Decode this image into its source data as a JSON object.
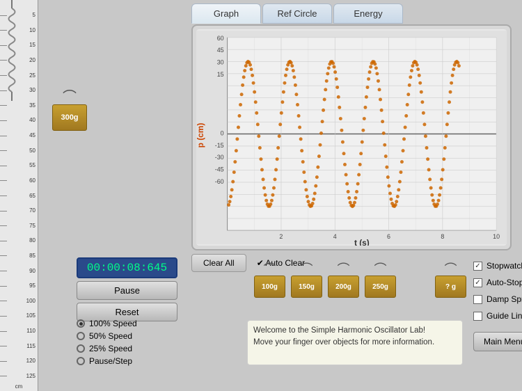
{
  "tabs": [
    {
      "id": "graph",
      "label": "Graph",
      "active": true
    },
    {
      "id": "ref-circle",
      "label": "Ref Circle",
      "active": false
    },
    {
      "id": "energy",
      "label": "Energy",
      "active": false
    }
  ],
  "graph": {
    "x_axis_label": "t (s)",
    "y_axis_label": "p (cm)",
    "x_max": 10,
    "y_min": -60,
    "y_max": 60,
    "x_ticks": [
      2,
      4,
      6,
      8,
      10
    ],
    "y_ticks": [
      60,
      45,
      30,
      15,
      0,
      -15,
      -30,
      -45,
      -60
    ]
  },
  "controls": {
    "clear_all_label": "Clear All",
    "auto_clear_label": "✔ Auto Clear"
  },
  "timer": {
    "display": "00:00:08:645",
    "pause_label": "Pause",
    "reset_label": "Reset"
  },
  "speed_options": [
    {
      "label": "100% Speed",
      "selected": true
    },
    {
      "label": "50% Speed",
      "selected": false
    },
    {
      "label": "25% Speed",
      "selected": false
    },
    {
      "label": "Pause/Step",
      "selected": false
    }
  ],
  "weights": [
    {
      "label": "100g"
    },
    {
      "label": "150g"
    },
    {
      "label": "200g"
    },
    {
      "label": "250g"
    }
  ],
  "question_weight": {
    "label": "? g"
  },
  "current_weight": {
    "label": "300g"
  },
  "info_box": {
    "line1": "Welcome to the Simple Harmonic Oscillator Lab!",
    "line2": "Move your finger over objects for more information."
  },
  "checkboxes": [
    {
      "label": "Stopwatch",
      "checked": true
    },
    {
      "label": "Auto-Stopwatch",
      "checked": true
    },
    {
      "label": "Damp Spring",
      "checked": false
    },
    {
      "label": "Guide Lines",
      "checked": false
    }
  ],
  "main_menu_label": "Main Menu",
  "ruler_ticks": [
    5,
    10,
    15,
    20,
    25,
    30,
    35,
    40,
    45,
    50,
    55,
    60,
    65,
    70,
    75,
    80,
    85,
    90,
    95,
    100,
    105,
    110,
    115,
    120,
    125
  ],
  "ruler_unit": "cm"
}
